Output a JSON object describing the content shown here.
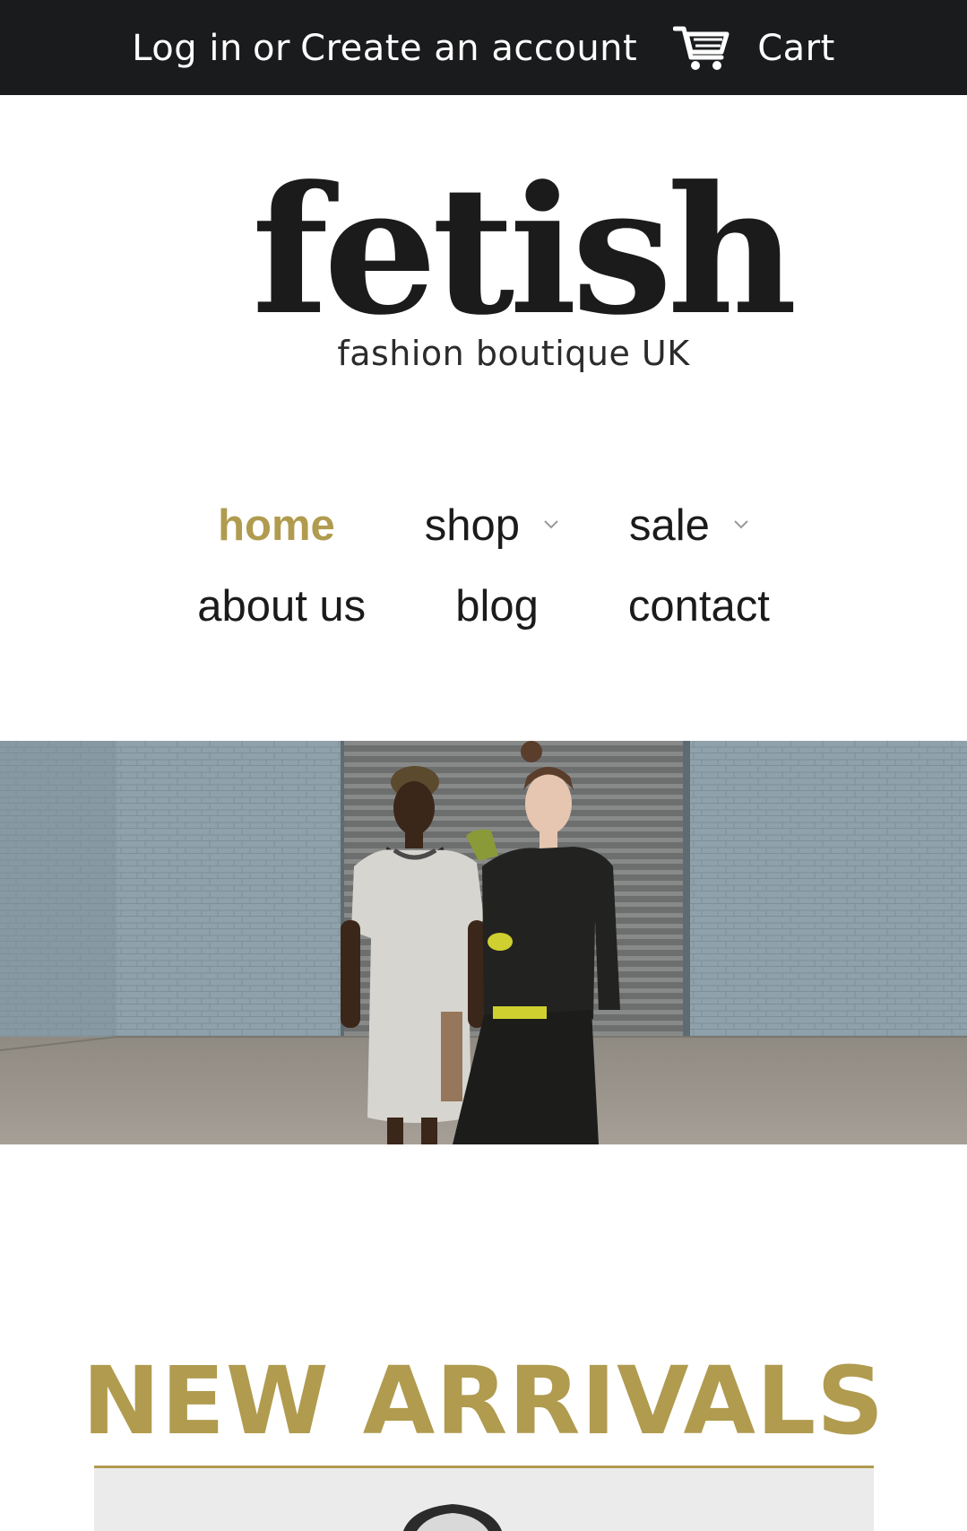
{
  "topbar": {
    "login_label": "Log in",
    "or_label": "or",
    "create_account_label": "Create an account",
    "cart_label": "Cart",
    "cart_icon": "cart-icon",
    "background": "#1a1b1c"
  },
  "logo": {
    "wordmark": "fetish",
    "tagline": "fashion boutique UK"
  },
  "nav": {
    "row1": [
      {
        "label": "home",
        "active": true
      },
      {
        "label": "shop",
        "has_dropdown": true,
        "icon": "chevron-down-icon"
      },
      {
        "label": "sale",
        "has_dropdown": true,
        "icon": "chevron-down-icon"
      }
    ],
    "row2": [
      {
        "label": "about us"
      },
      {
        "label": "blog"
      },
      {
        "label": "contact"
      }
    ],
    "active_color": "#b09b4f"
  },
  "hero": {
    "image": "two-models-in-front-of-shutter"
  },
  "new_arrivals": {
    "title": "NEW ARRIVALS",
    "accent": "#b09b4f"
  }
}
